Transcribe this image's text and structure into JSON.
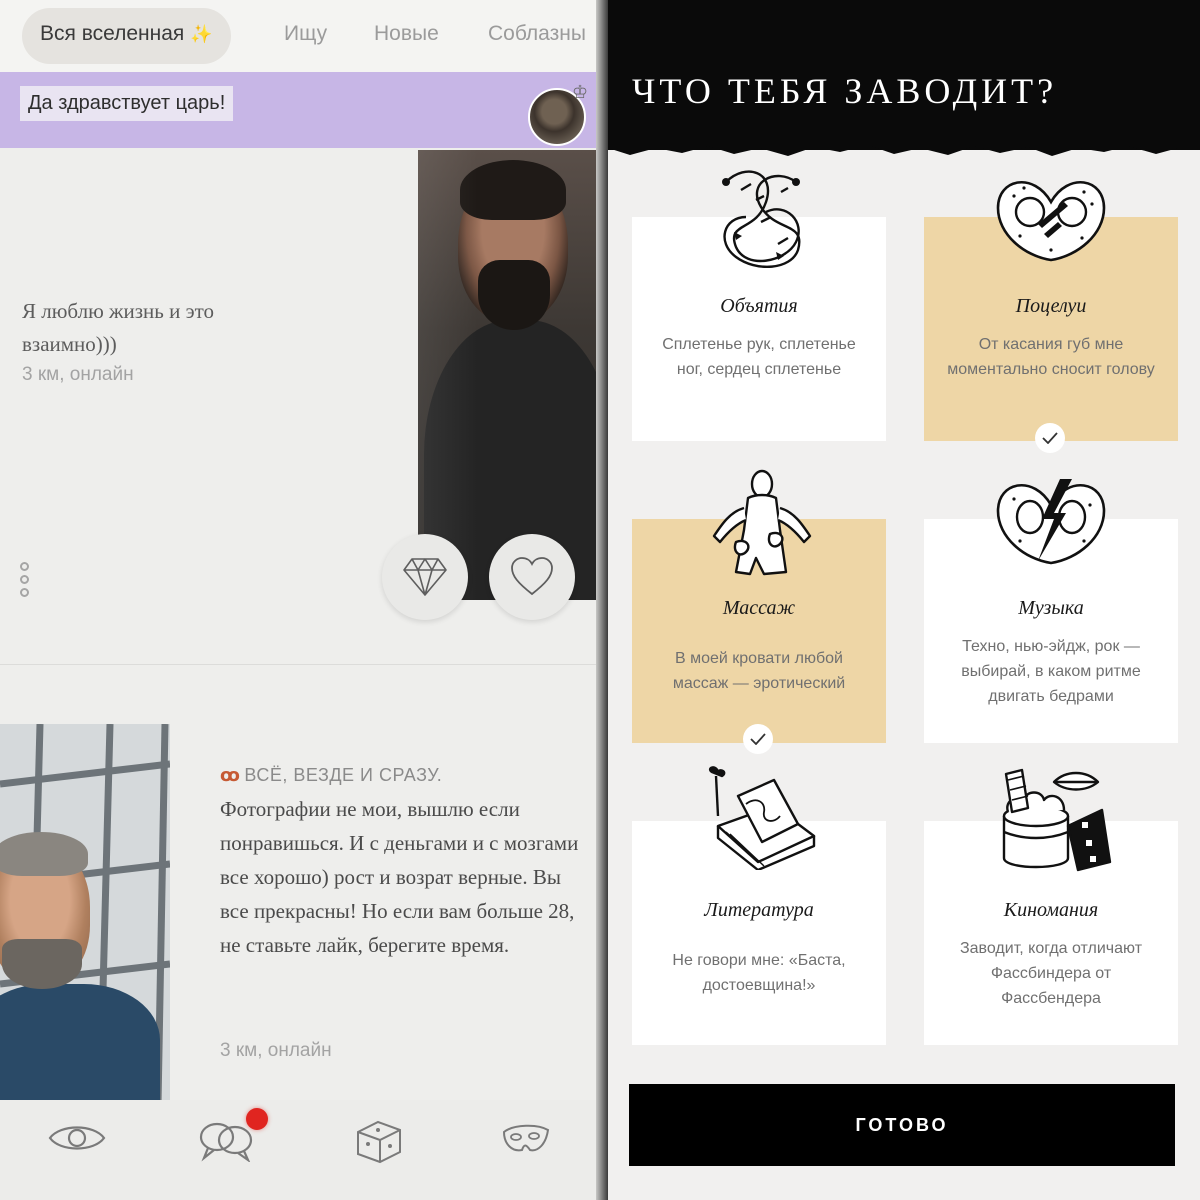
{
  "left": {
    "tabs": [
      {
        "label": "Вся вселенная",
        "active": true
      },
      {
        "label": "Ищу",
        "active": false
      },
      {
        "label": "Новые",
        "active": false
      },
      {
        "label": "Соблазны",
        "active": false
      }
    ],
    "banner": {
      "label": "Да здравствует царь!",
      "color": "#c7b6e6"
    },
    "profile1": {
      "description": "Я люблю жизнь и это взаимно)))",
      "meta": "3 км, онлайн"
    },
    "profile2": {
      "heading": "ВСЁ, ВЕЗДЕ И СРАЗУ.",
      "description": "Фотографии не мои, вышлю если понравишься. И с деньгами и с мозгами все хорошо) рост и возрат верные. Вы все прекрасны! Но если вам больше 28, не ставьте лайк, берегите время.",
      "meta": "3 км, онлайн"
    },
    "actions": {
      "diamond_icon": "diamond-icon",
      "heart_icon": "heart-icon"
    },
    "nav": [
      {
        "icon": "eye-icon"
      },
      {
        "icon": "chat-bubbles-icon",
        "badge_color": "#e02520"
      },
      {
        "icon": "dice-icon"
      },
      {
        "icon": "mask-icon"
      }
    ]
  },
  "right": {
    "title": "ЧТО ТЕБЯ ЗАВОДИТ?",
    "selected_color": "#eed6a6",
    "cards": [
      {
        "title": "Объятия",
        "description": "Сплетенье рук, сплетенье ног, сердец сплетенье",
        "selected": false,
        "icon": "intertwined-snakes-icon"
      },
      {
        "title": "Поцелуи",
        "description": "От касания губ мне моментально сносит голову",
        "selected": true,
        "icon": "pretzel-icon"
      },
      {
        "title": "Массаж",
        "description": "В моей кровати любой массаж — эротический",
        "selected": true,
        "icon": "massage-figure-icon"
      },
      {
        "title": "Музыка",
        "description": "Техно, нью-эйдж, рок — выбирай, в каком ритме двигать бедрами",
        "selected": false,
        "icon": "pretzel-lightning-icon"
      },
      {
        "title": "Литература",
        "description": "Не говори мне: «Баста, достоевщина!»",
        "selected": false,
        "icon": "book-icon"
      },
      {
        "title": "Киномания",
        "description": "Заводит, когда отличают Фассбиндера от Фассбендера",
        "selected": false,
        "icon": "popcorn-film-icon"
      }
    ],
    "done_button": "ГОТОВО"
  }
}
